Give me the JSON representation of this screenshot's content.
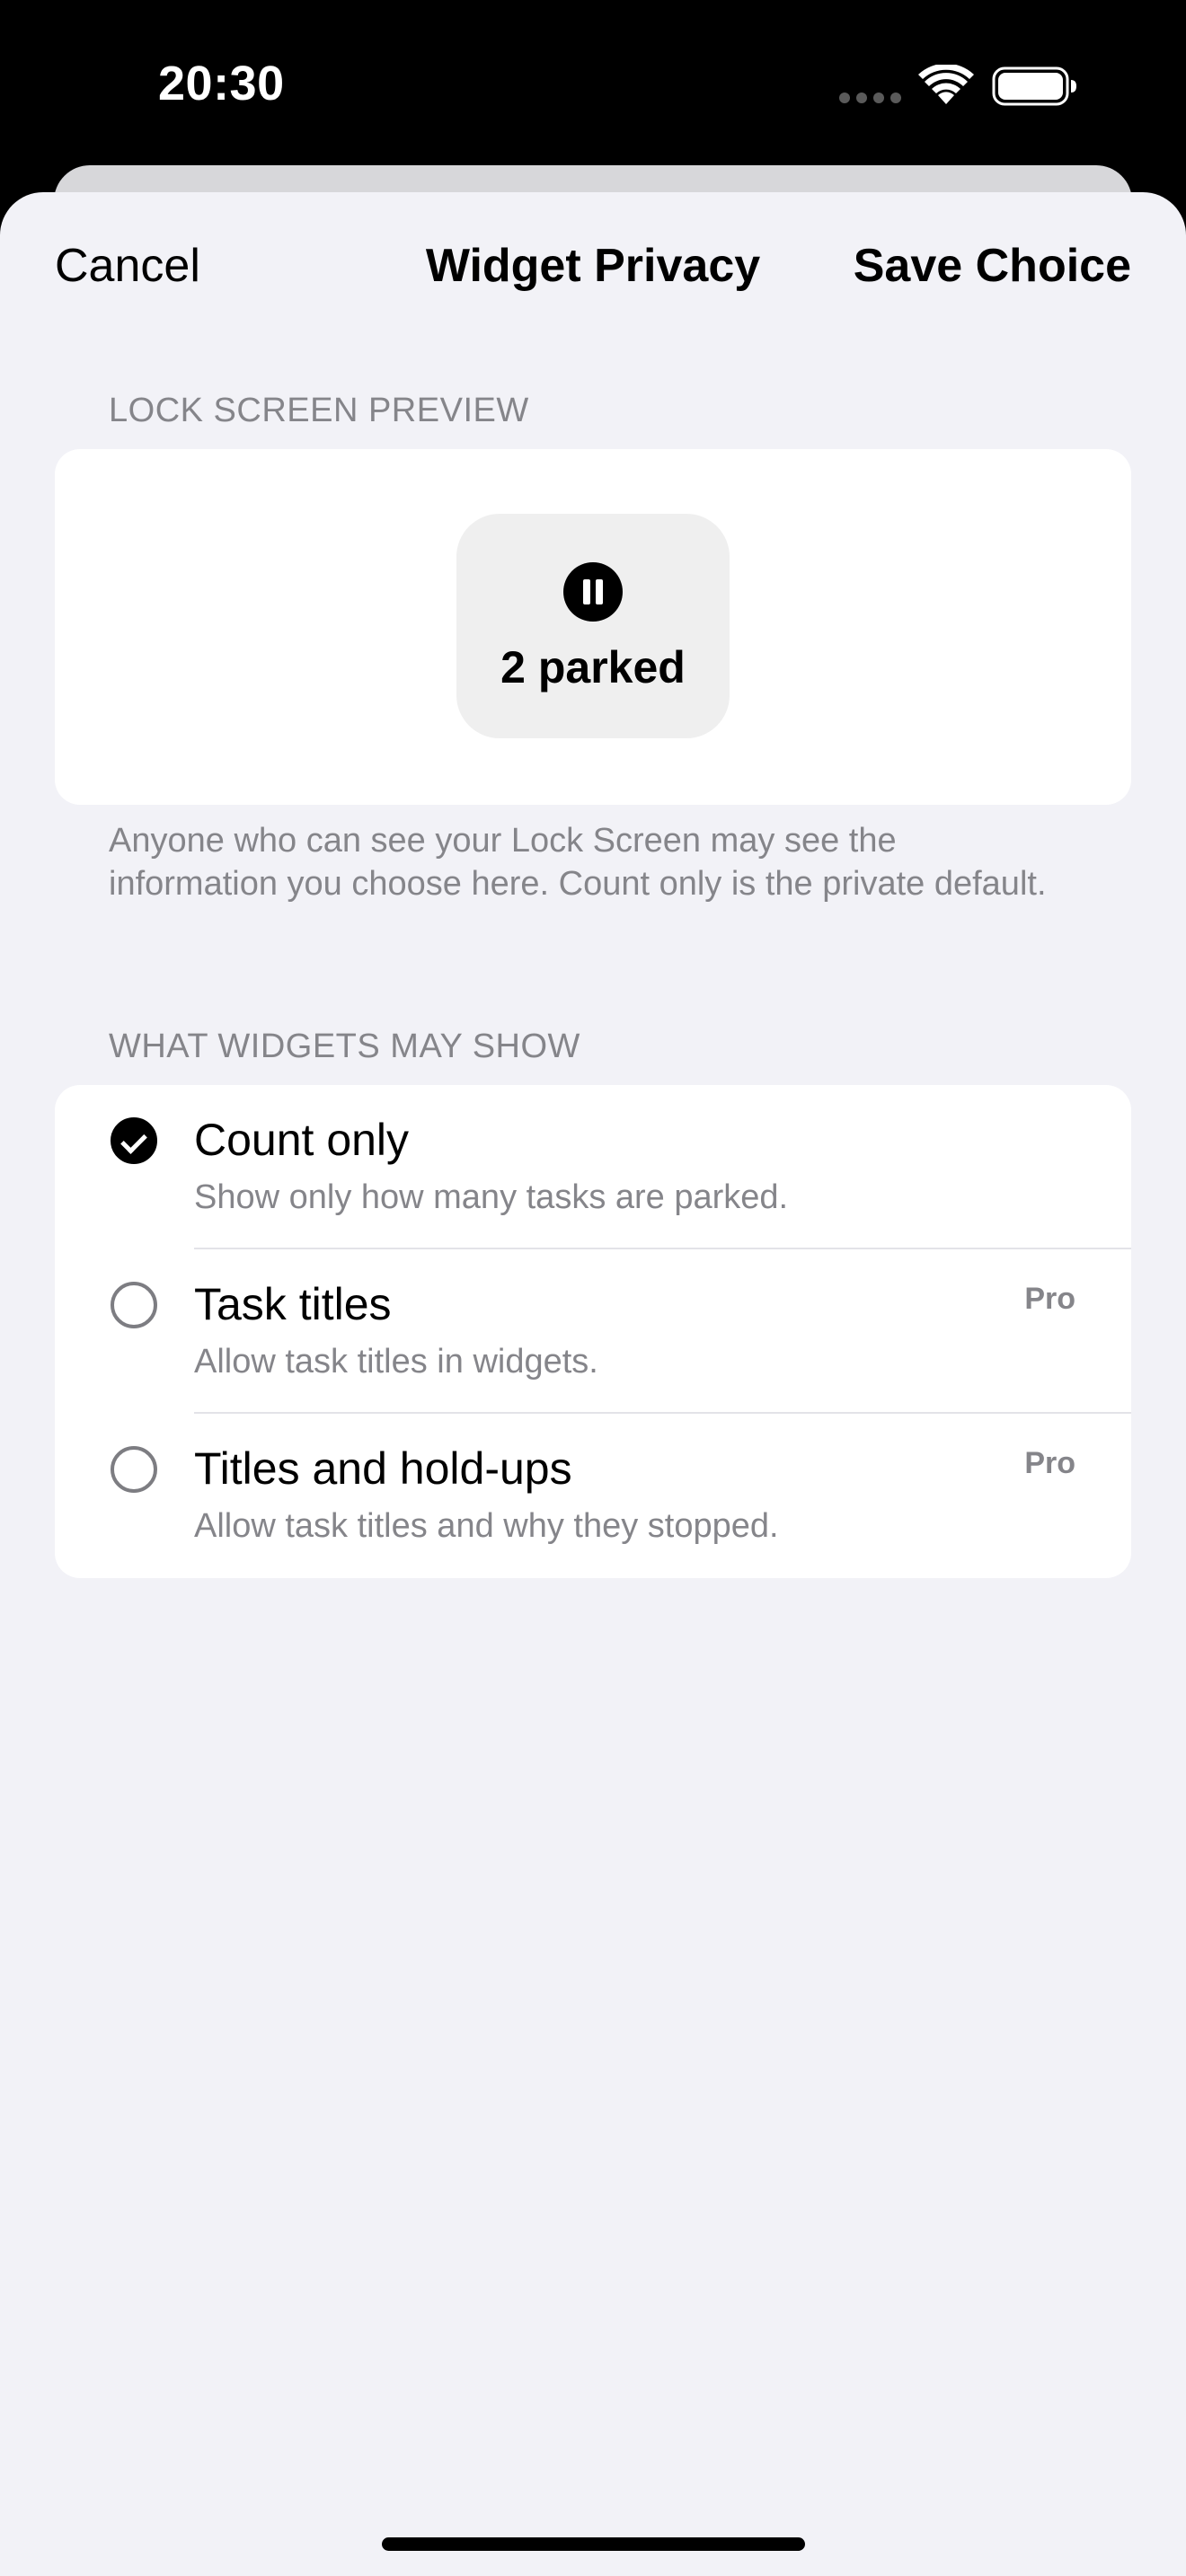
{
  "status_bar": {
    "time": "20:30",
    "icons": [
      "cellular-dots-icon",
      "wifi-icon",
      "battery-icon"
    ]
  },
  "nav": {
    "cancel_label": "Cancel",
    "title": "Widget Privacy",
    "save_label": "Save Choice"
  },
  "preview_section": {
    "header": "LOCK SCREEN PREVIEW",
    "widget_icon": "pause-circle-icon",
    "widget_text": "2 parked",
    "footer": "Anyone who can see your Lock Screen may see the information you choose here. Count only is the private default."
  },
  "options_section": {
    "header": "WHAT WIDGETS MAY SHOW",
    "selected_index": 0,
    "options": [
      {
        "title": "Count only",
        "subtitle": "Show only how many tasks are parked.",
        "badge": ""
      },
      {
        "title": "Task titles",
        "subtitle": "Allow task titles in widgets.",
        "badge": "Pro"
      },
      {
        "title": "Titles and hold-ups",
        "subtitle": "Allow task titles and why they stopped.",
        "badge": "Pro"
      }
    ]
  },
  "colors": {
    "sheet_background": "#f2f2f7",
    "card_background": "#ffffff",
    "secondary_text": "#85858a",
    "accent": "#000000"
  }
}
